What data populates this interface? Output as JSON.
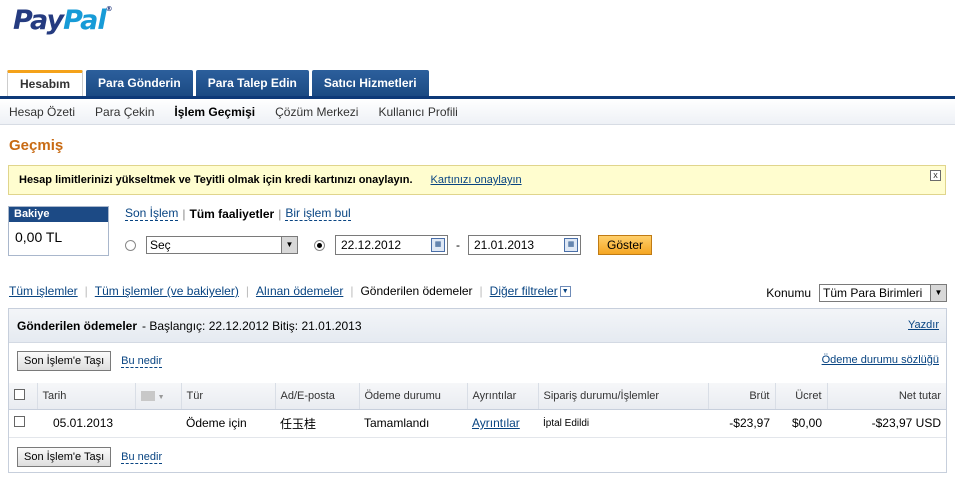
{
  "logo": {
    "part1": "Pay",
    "part2": "Pal",
    "mark": "®"
  },
  "tabs": [
    {
      "label": "Hesabım",
      "active": true
    },
    {
      "label": "Para Gönderin",
      "active": false
    },
    {
      "label": "Para Talep Edin",
      "active": false
    },
    {
      "label": "Satıcı Hizmetleri",
      "active": false
    }
  ],
  "subnav": [
    "Hesap Özeti",
    "Para Çekin",
    "İşlem Geçmişi",
    "Çözüm Merkezi",
    "Kullanıcı Profili"
  ],
  "page_title": "Geçmiş",
  "notice": {
    "text": "Hesap limitlerinizi yükseltmek ve Teyitli olmak için kredi kartınızı onaylayın.",
    "link": "Kartınızı onaylayın",
    "close": "x"
  },
  "balance": {
    "label": "Bakiye",
    "value": "0,00 TL"
  },
  "filters": {
    "recent": "Son İşlem",
    "all": "Tüm faaliyetler",
    "find": "Bir işlem bul"
  },
  "range": {
    "select_value": "Seç",
    "date_from": "22.12.2012",
    "dash": "-",
    "date_to": "21.01.2013",
    "show_button": "Göster"
  },
  "tx_nav": {
    "items": [
      "Tüm işlemler",
      "Tüm işlemler (ve bakiyeler)",
      "Alınan ödemeler",
      "Gönderilen ödemeler",
      "Diğer filtreler"
    ]
  },
  "currency": {
    "label": "Konumu",
    "value": "Tüm Para Birimleri"
  },
  "panel": {
    "title": "Gönderilen ödemeler",
    "range_text": "- Başlangıç: 22.12.2012 Bitiş: 21.01.2013",
    "print": "Yazdır",
    "move_button": "Son İşlem'e Taşı",
    "what_link": "Bu nedir",
    "glossary": "Ödeme durumu sözlüğü"
  },
  "table": {
    "headers": [
      "Tarih",
      "Tür",
      "Ad/E-posta",
      "Ödeme durumu",
      "Ayrıntılar",
      "Sipariş durumu/İşlemler",
      "Brüt",
      "Ücret",
      "Net tutar"
    ],
    "rows": [
      {
        "date": "05.01.2013",
        "type": "Ödeme için",
        "name": "任玉桂",
        "status": "Tamamlandı",
        "details": "Ayrıntılar",
        "order": "İptal Edildi",
        "gross": "-$23,97",
        "fee": "$0,00",
        "net": "-$23,97 USD"
      }
    ]
  }
}
